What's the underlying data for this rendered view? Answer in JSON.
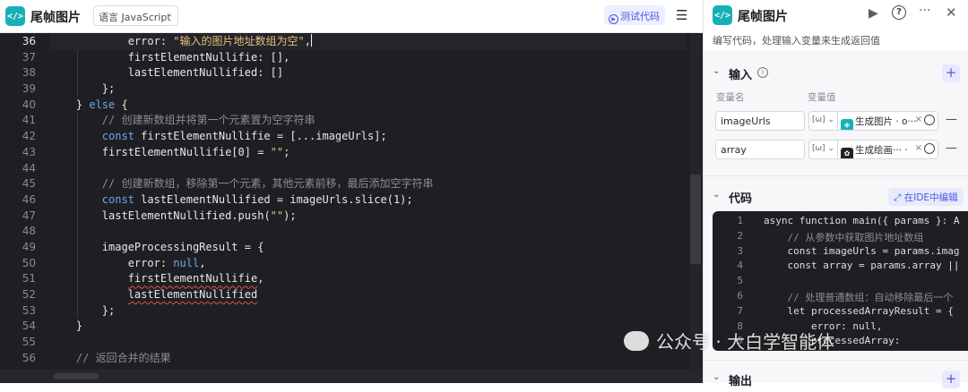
{
  "left_header": {
    "logo_glyph": "</>",
    "title": "尾帧图片",
    "language_label": "语言",
    "language_value": "JavaScript",
    "test_button_label": "测试代码"
  },
  "editor": {
    "line_numbers": [
      "36",
      "37",
      "38",
      "39",
      "40",
      "41",
      "42",
      "43",
      "44",
      "45",
      "46",
      "47",
      "48",
      "49",
      "50",
      "51",
      "52",
      "53",
      "54",
      "55",
      "56"
    ],
    "active_line": "36"
  },
  "right_panel": {
    "title": "尾帧图片",
    "description": "编写代码，处理输入变量来生成返回值",
    "input_section_title": "输入",
    "col_name_label": "变量名",
    "col_value_label": "变量值",
    "variables": [
      {
        "name": "imageUrls",
        "type": "[ω]",
        "ref": "生成图片 · o···",
        "ref_color": "#17b0b7"
      },
      {
        "name": "array",
        "type": "[ω]",
        "ref": "生成绘画··· ·",
        "ref_color": "#222222"
      }
    ],
    "code_section_title": "代码",
    "ide_button_label": "在IDE中编辑",
    "output_section_title": "输出",
    "mini_code_lines": [
      {
        "n": "1",
        "t": "async function main({ params }: A"
      },
      {
        "n": "2",
        "t": "    // 从参数中获取图片地址数组"
      },
      {
        "n": "3",
        "t": "    const imageUrls = params.imag"
      },
      {
        "n": "4",
        "t": "    const array = params.array ||"
      },
      {
        "n": "5",
        "t": ""
      },
      {
        "n": "6",
        "t": "    // 处理普通数组：自动移除最后一个"
      },
      {
        "n": "7",
        "t": "    let processedArrayResult = {"
      },
      {
        "n": "8",
        "t": "        error: null,"
      },
      {
        "n": "9",
        "t": "        processedArray:"
      }
    ]
  },
  "watermark": "公众号 · 大白学智能体"
}
